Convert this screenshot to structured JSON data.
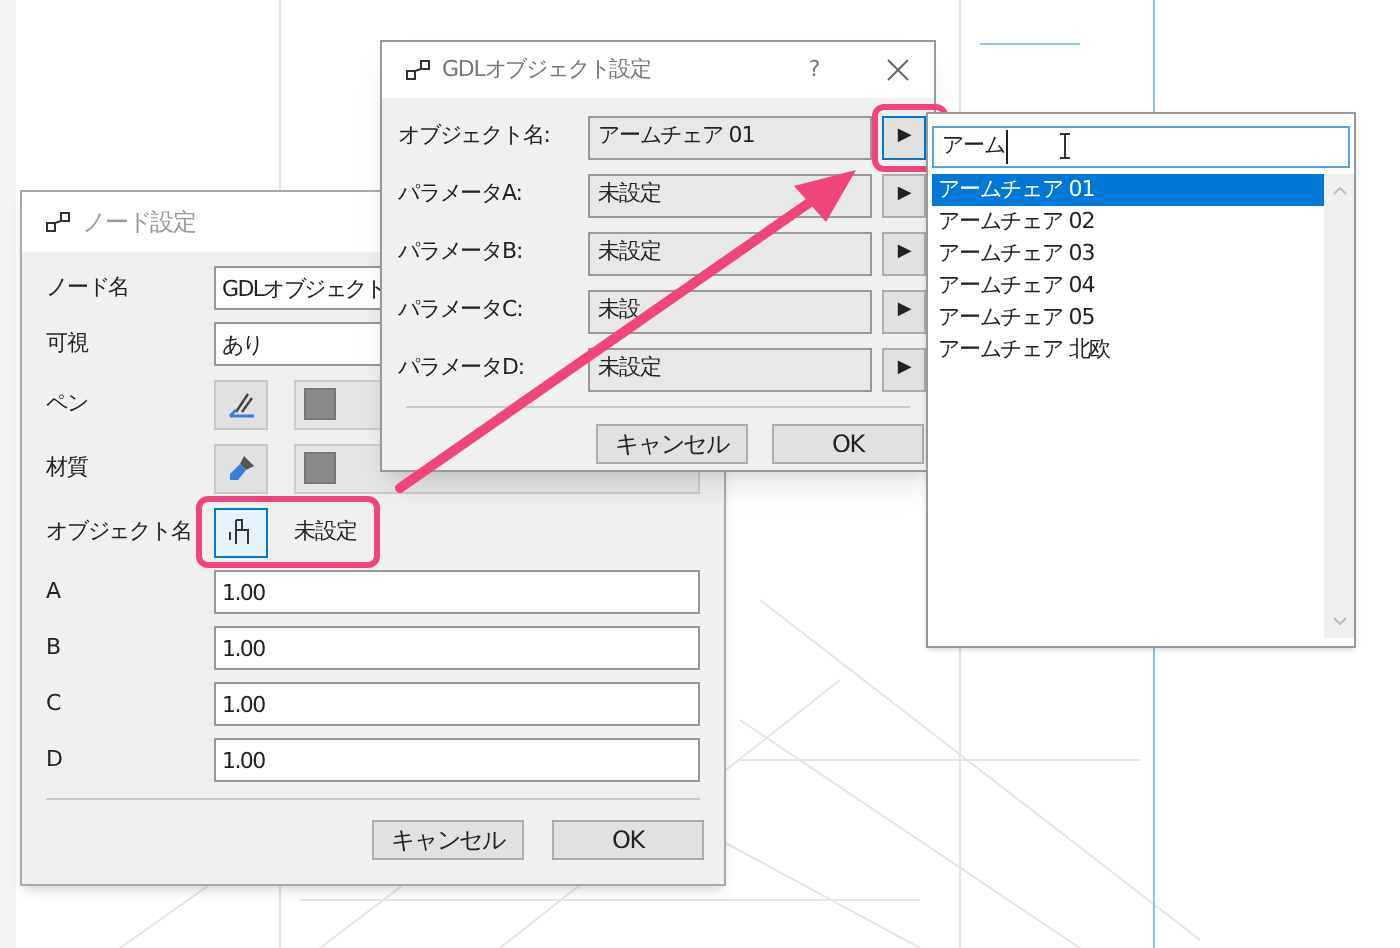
{
  "node_dialog": {
    "title": "ノード設定",
    "rows": [
      {
        "kind": "text",
        "label": "ノード名",
        "value": "GDLオブジェクト"
      },
      {
        "kind": "text",
        "label": "可視",
        "value": "あり"
      },
      {
        "kind": "pen",
        "label": "ペン"
      },
      {
        "kind": "material",
        "label": "材質"
      },
      {
        "kind": "object",
        "label": "オブジェクト名",
        "value": "未設定",
        "highlighted": true
      },
      {
        "kind": "number",
        "label": "A",
        "value": "1.00"
      },
      {
        "kind": "number",
        "label": "B",
        "value": "1.00"
      },
      {
        "kind": "number",
        "label": "C",
        "value": "1.00"
      },
      {
        "kind": "number",
        "label": "D",
        "value": "1.00"
      }
    ],
    "buttons": [
      "キャンセル",
      "OK"
    ]
  },
  "gdl_dialog": {
    "title": "GDLオブジェクト設定",
    "help": "?",
    "rows": [
      {
        "label": "オブジェクト名:",
        "value": "アームチェア 01",
        "arrow": "▶",
        "highlighted": true
      },
      {
        "label": "パラメータA:",
        "value": "未設定",
        "arrow": "▶",
        "highlighted": false
      },
      {
        "label": "パラメータB:",
        "value": "未設定",
        "arrow": "▶",
        "highlighted": false
      },
      {
        "label": "パラメータC:",
        "value": "未設",
        "arrow": "▶",
        "highlighted": false
      },
      {
        "label": "パラメータD:",
        "value": "未設定",
        "arrow": "▶",
        "highlighted": false
      }
    ],
    "buttons": [
      "キャンセル",
      "OK"
    ]
  },
  "picker": {
    "search": "アーム",
    "items": [
      {
        "label": "アームチェア 01",
        "selected": true
      },
      {
        "label": "アームチェア 02",
        "selected": false
      },
      {
        "label": "アームチェア 03",
        "selected": false
      },
      {
        "label": "アームチェア 04",
        "selected": false
      },
      {
        "label": "アームチェア 05",
        "selected": false
      },
      {
        "label": "アームチェア 北欧",
        "selected": false
      }
    ]
  }
}
